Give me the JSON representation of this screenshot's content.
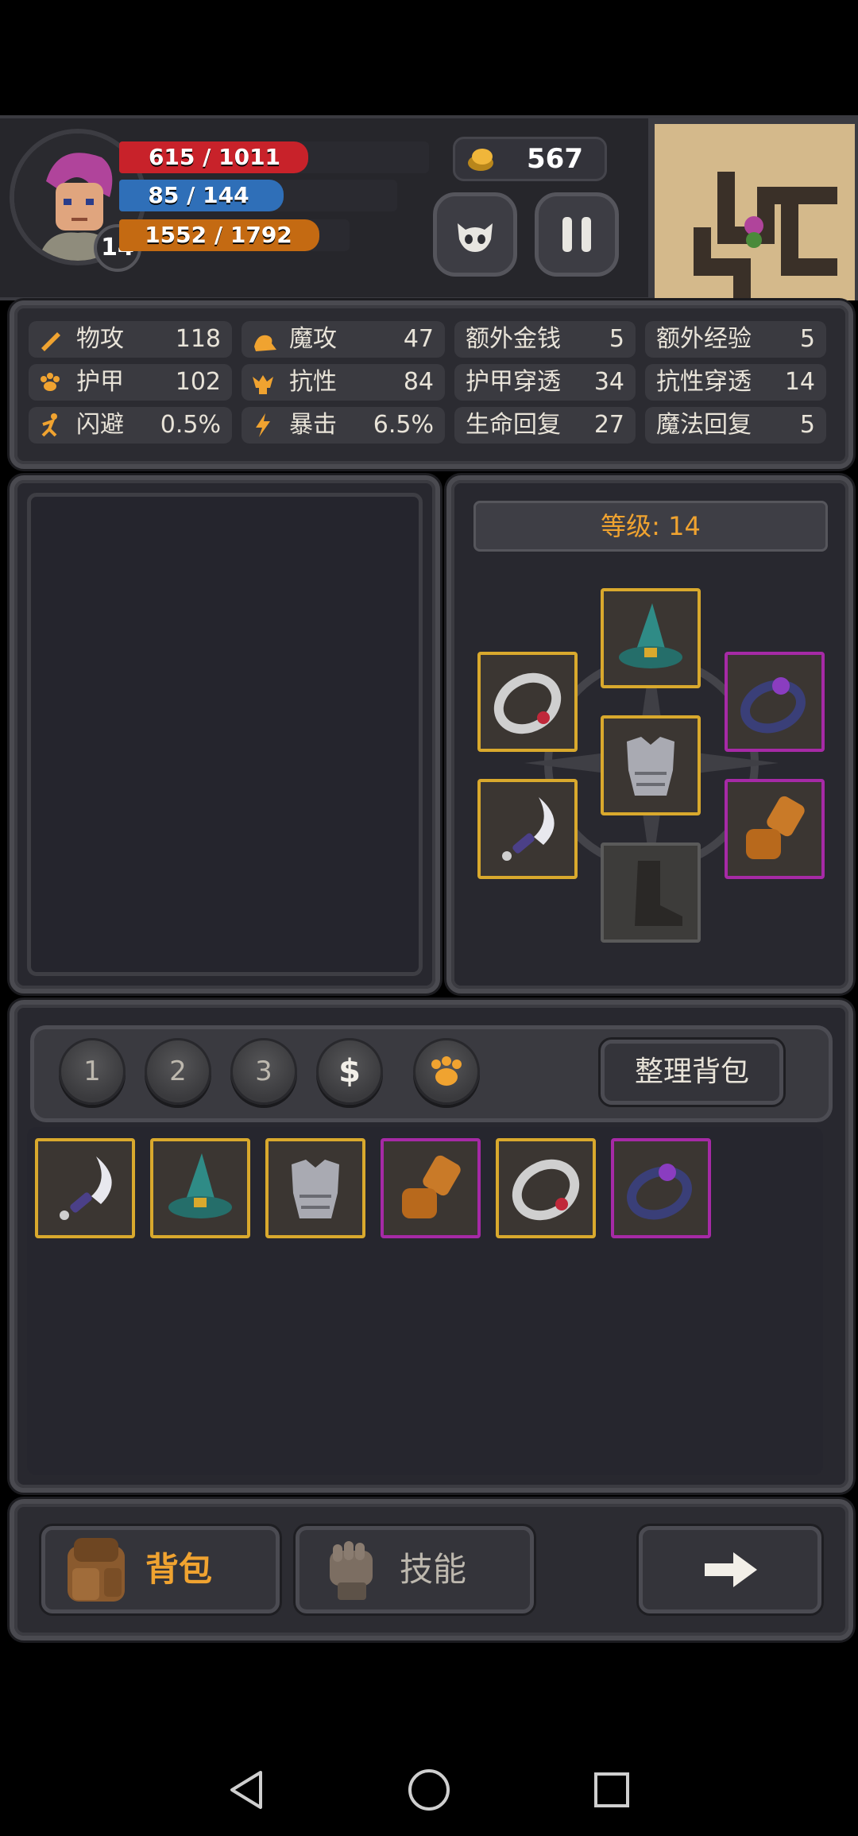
{
  "player": {
    "level": "14",
    "hp_text": "615 / 1011",
    "hp_fraction": 0.61,
    "mp_text": "85 / 144",
    "mp_fraction": 0.59,
    "xp_text": "1552 / 1792",
    "xp_fraction": 0.87,
    "gold": "567"
  },
  "stats": [
    {
      "label": "物攻",
      "value": "118",
      "icon": "sword-icon"
    },
    {
      "label": "魔攻",
      "value": "47",
      "icon": "magic-hand-icon"
    },
    {
      "label": "额外金钱",
      "value": "5"
    },
    {
      "label": "额外经验",
      "value": "5"
    },
    {
      "label": "护甲",
      "value": "102",
      "icon": "paw-armor-icon"
    },
    {
      "label": "抗性",
      "value": "84",
      "icon": "resist-icon"
    },
    {
      "label": "护甲穿透",
      "value": "34"
    },
    {
      "label": "抗性穿透",
      "value": "14"
    },
    {
      "label": "闪避",
      "value": "0.5%",
      "icon": "running-icon"
    },
    {
      "label": "暴击",
      "value": "6.5%",
      "icon": "lightning-icon"
    },
    {
      "label": "生命回复",
      "value": "27"
    },
    {
      "label": "魔法回复",
      "value": "5"
    }
  ],
  "equipment": {
    "level_label": "等级: 14",
    "slots": [
      {
        "name": "hat",
        "icon": "wizard-hat-icon",
        "rarity": "gold"
      },
      {
        "name": "ring-left",
        "icon": "silver-ring-icon",
        "rarity": "gold"
      },
      {
        "name": "ring-right",
        "icon": "purple-ring-icon",
        "rarity": "purple"
      },
      {
        "name": "armor",
        "icon": "chest-armor-icon",
        "rarity": "gold"
      },
      {
        "name": "weapon",
        "icon": "curved-dagger-icon",
        "rarity": "gold"
      },
      {
        "name": "gloves",
        "icon": "gauntlet-icon",
        "rarity": "purple"
      },
      {
        "name": "boots",
        "icon": "boot-icon",
        "rarity": "empty"
      }
    ]
  },
  "inventory": {
    "tabs": [
      "1",
      "2",
      "3",
      "$"
    ],
    "sort_label": "整理背包",
    "items": [
      {
        "icon": "curved-dagger-icon",
        "rarity": "gold"
      },
      {
        "icon": "wizard-hat-icon",
        "rarity": "gold"
      },
      {
        "icon": "chest-armor-icon",
        "rarity": "gold"
      },
      {
        "icon": "gauntlet-icon",
        "rarity": "purple"
      },
      {
        "icon": "silver-ring-icon",
        "rarity": "gold"
      },
      {
        "icon": "purple-ring-icon",
        "rarity": "purple"
      }
    ]
  },
  "bottom_nav": {
    "bag_label": "背包",
    "skills_label": "技能"
  },
  "colors": {
    "hp": "#c8222a",
    "mp": "#2f6fb8",
    "xp": "#c46a12",
    "accent": "#f0a330",
    "gold_border": "#d9a92d",
    "purple_border": "#a62aa6"
  }
}
